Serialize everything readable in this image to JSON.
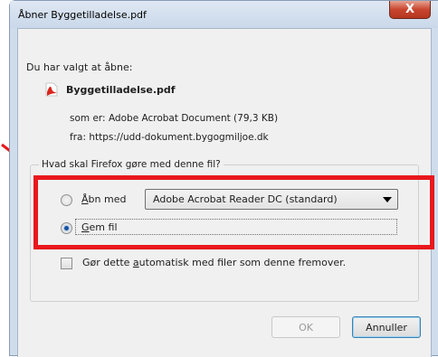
{
  "window": {
    "title": "Åbner Byggetilladelse.pdf",
    "close_glyph": "X"
  },
  "intro": "Du har valgt at åbne:",
  "file": {
    "name": "Byggetilladelse.pdf",
    "icon": "pdf-file-icon",
    "type_label": "som er:",
    "type_value": "Adobe Acrobat Document (79,3 KB)",
    "from_label": "fra:",
    "from_value": "https://udd-dokument.bygogmiljoe.dk"
  },
  "question": "Hvad skal Firefox gøre med denne fil?",
  "options": {
    "open_with": {
      "label_accel": "Å",
      "label_rest": "bn med",
      "selected": false,
      "app": "Adobe Acrobat Reader DC  (standard)"
    },
    "save_file": {
      "label_accel": "G",
      "label_rest": "em fil",
      "selected": true
    }
  },
  "auto_checkbox": {
    "label_before": "Gør dette ",
    "label_accel": "a",
    "label_after": "utomatisk med filer som denne fremover.",
    "checked": false
  },
  "buttons": {
    "ok": "OK",
    "cancel": "Annuller"
  },
  "colors": {
    "highlight": "#e8181d",
    "radio_selected": "#1a53a0",
    "close_button": "#c8452e"
  }
}
